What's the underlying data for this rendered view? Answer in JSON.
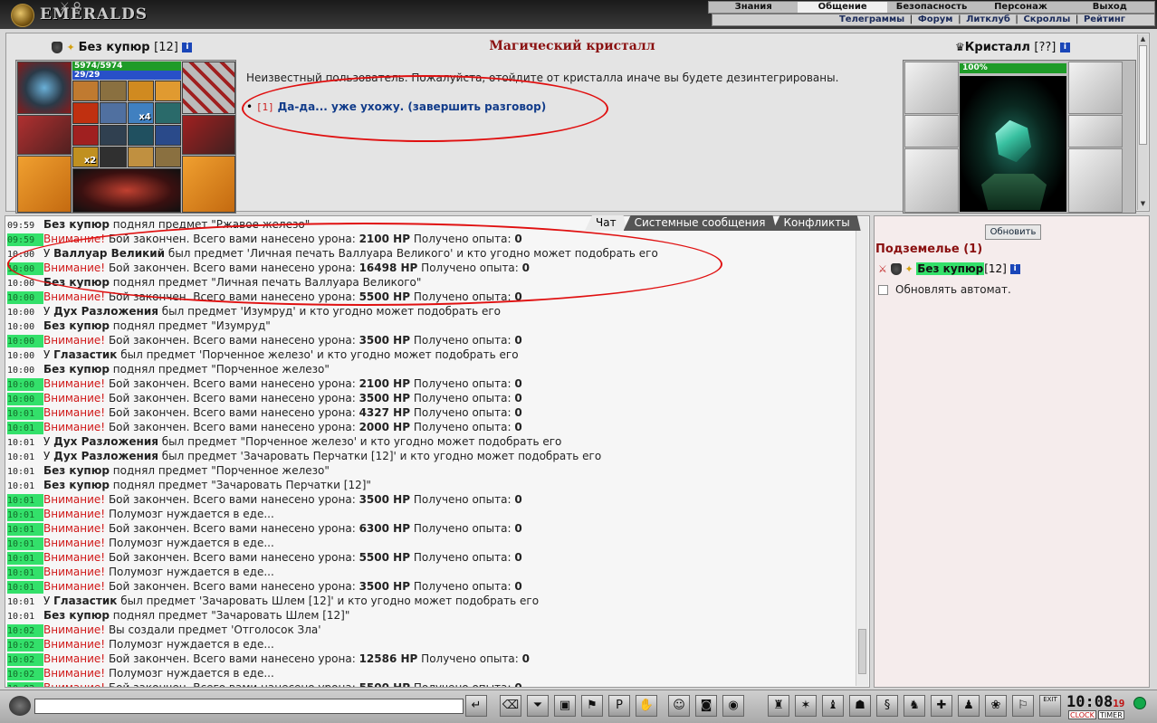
{
  "app": {
    "logo_text": "EMERALDS"
  },
  "topmenu": [
    "Знания",
    "Общение",
    "Безопасность",
    "Персонаж",
    "Выход"
  ],
  "submenu": [
    "Телеграммы",
    "Форум",
    "Литклуб",
    "Скроллы",
    "Рейтинг"
  ],
  "player": {
    "name": "Без купюр",
    "level": "[12]",
    "hp": "5974/5974",
    "mp": "29/29",
    "counts": {
      "slot_a": "x4",
      "slot_b": "x2"
    }
  },
  "dialog": {
    "title": "Магический кристалл",
    "text": "Неизвестный пользователь. Пожалуйста, отойдите от кристалла иначе вы будете дезинтегрированы.",
    "option_num": "[1]",
    "option_text": "Да-да... уже ухожу. (завершить разговор)"
  },
  "npc": {
    "name": "Кристалл",
    "level": "[??]",
    "hp": "100%"
  },
  "tabs": [
    "Чат",
    "Системные сообщения",
    "Конфликты"
  ],
  "chat_lines": [
    {
      "t": "09:59",
      "hl": false,
      "parts": [
        [
          "b",
          "Без купюр"
        ],
        [
          "",
          "поднял предмет \"Ржавое железо\""
        ]
      ]
    },
    {
      "t": "09:59",
      "hl": true,
      "parts": [
        [
          "w",
          "Внимание!"
        ],
        [
          "",
          "Бой закончен. Всего вами нанесено урона:"
        ],
        [
          "b",
          "2100 HP"
        ],
        [
          "",
          "Получено опыта:"
        ],
        [
          "b",
          "0"
        ]
      ]
    },
    {
      "t": "10:00",
      "hl": false,
      "parts": [
        [
          "",
          "У"
        ],
        [
          "b",
          "Валлуар Великий"
        ],
        [
          "",
          "был предмет 'Личная печать Валлуара Великого' и кто угодно может подобрать его"
        ]
      ]
    },
    {
      "t": "10:00",
      "hl": true,
      "parts": [
        [
          "w",
          "Внимание!"
        ],
        [
          "",
          "Бой закончен. Всего вами нанесено урона:"
        ],
        [
          "b",
          "16498 HP"
        ],
        [
          "",
          "Получено опыта:"
        ],
        [
          "b",
          "0"
        ]
      ]
    },
    {
      "t": "10:00",
      "hl": false,
      "parts": [
        [
          "b",
          "Без купюр"
        ],
        [
          "",
          "поднял предмет \"Личная печать Валлуара Великого\""
        ]
      ]
    },
    {
      "t": "10:00",
      "hl": true,
      "parts": [
        [
          "w",
          "Внимание!"
        ],
        [
          "",
          "Бой закончен. Всего вами нанесено урона:"
        ],
        [
          "b",
          "5500 HP"
        ],
        [
          "",
          "Получено опыта:"
        ],
        [
          "b",
          "0"
        ]
      ]
    },
    {
      "t": "10:00",
      "hl": false,
      "parts": [
        [
          "",
          "У"
        ],
        [
          "b",
          "Дух Разложения"
        ],
        [
          "",
          "был предмет 'Изумруд' и кто угодно может подобрать его"
        ]
      ]
    },
    {
      "t": "10:00",
      "hl": false,
      "parts": [
        [
          "b",
          "Без купюр"
        ],
        [
          "",
          "поднял предмет \"Изумруд\""
        ]
      ]
    },
    {
      "t": "10:00",
      "hl": true,
      "parts": [
        [
          "w",
          "Внимание!"
        ],
        [
          "",
          "Бой закончен. Всего вами нанесено урона:"
        ],
        [
          "b",
          "3500 HP"
        ],
        [
          "",
          "Получено опыта:"
        ],
        [
          "b",
          "0"
        ]
      ]
    },
    {
      "t": "10:00",
      "hl": false,
      "parts": [
        [
          "",
          "У"
        ],
        [
          "b",
          "Глазастик"
        ],
        [
          "",
          "был предмет 'Порченное железо' и кто угодно может подобрать его"
        ]
      ]
    },
    {
      "t": "10:00",
      "hl": false,
      "parts": [
        [
          "b",
          "Без купюр"
        ],
        [
          "",
          "поднял предмет \"Порченное железо\""
        ]
      ]
    },
    {
      "t": "10:00",
      "hl": true,
      "parts": [
        [
          "w",
          "Внимание!"
        ],
        [
          "",
          "Бой закончен. Всего вами нанесено урона:"
        ],
        [
          "b",
          "2100 HP"
        ],
        [
          "",
          "Получено опыта:"
        ],
        [
          "b",
          "0"
        ]
      ]
    },
    {
      "t": "10:00",
      "hl": true,
      "parts": [
        [
          "w",
          "Внимание!"
        ],
        [
          "",
          "Бой закончен. Всего вами нанесено урона:"
        ],
        [
          "b",
          "3500 HP"
        ],
        [
          "",
          "Получено опыта:"
        ],
        [
          "b",
          "0"
        ]
      ]
    },
    {
      "t": "10:01",
      "hl": true,
      "parts": [
        [
          "w",
          "Внимание!"
        ],
        [
          "",
          "Бой закончен. Всего вами нанесено урона:"
        ],
        [
          "b",
          "4327 HP"
        ],
        [
          "",
          "Получено опыта:"
        ],
        [
          "b",
          "0"
        ]
      ]
    },
    {
      "t": "10:01",
      "hl": true,
      "parts": [
        [
          "w",
          "Внимание!"
        ],
        [
          "",
          "Бой закончен. Всего вами нанесено урона:"
        ],
        [
          "b",
          "2000 HP"
        ],
        [
          "",
          "Получено опыта:"
        ],
        [
          "b",
          "0"
        ]
      ]
    },
    {
      "t": "10:01",
      "hl": false,
      "parts": [
        [
          "",
          "У"
        ],
        [
          "b",
          "Дух Разложения"
        ],
        [
          "",
          "был предмет \"Порченное железо' и кто угодно может подобрать его"
        ]
      ]
    },
    {
      "t": "10:01",
      "hl": false,
      "parts": [
        [
          "",
          "У"
        ],
        [
          "b",
          "Дух Разложения"
        ],
        [
          "",
          "был предмет 'Зачаровать Перчатки [12]' и кто угодно может подобрать его"
        ]
      ]
    },
    {
      "t": "10:01",
      "hl": false,
      "parts": [
        [
          "b",
          "Без купюр"
        ],
        [
          "",
          "поднял предмет \"Порченное железо\""
        ]
      ]
    },
    {
      "t": "10:01",
      "hl": false,
      "parts": [
        [
          "b",
          "Без купюр"
        ],
        [
          "",
          "поднял предмет \"Зачаровать Перчатки [12]\""
        ]
      ]
    },
    {
      "t": "10:01",
      "hl": true,
      "parts": [
        [
          "w",
          "Внимание!"
        ],
        [
          "",
          "Бой закончен. Всего вами нанесено урона:"
        ],
        [
          "b",
          "3500 HP"
        ],
        [
          "",
          "Получено опыта:"
        ],
        [
          "b",
          "0"
        ]
      ]
    },
    {
      "t": "10:01",
      "hl": true,
      "parts": [
        [
          "w",
          "Внимание!"
        ],
        [
          "",
          "Полумозг нуждается в еде..."
        ]
      ]
    },
    {
      "t": "10:01",
      "hl": true,
      "parts": [
        [
          "w",
          "Внимание!"
        ],
        [
          "",
          "Бой закончен. Всего вами нанесено урона:"
        ],
        [
          "b",
          "6300 HP"
        ],
        [
          "",
          "Получено опыта:"
        ],
        [
          "b",
          "0"
        ]
      ]
    },
    {
      "t": "10:01",
      "hl": true,
      "parts": [
        [
          "w",
          "Внимание!"
        ],
        [
          "",
          "Полумозг нуждается в еде..."
        ]
      ]
    },
    {
      "t": "10:01",
      "hl": true,
      "parts": [
        [
          "w",
          "Внимание!"
        ],
        [
          "",
          "Бой закончен. Всего вами нанесено урона:"
        ],
        [
          "b",
          "5500 HP"
        ],
        [
          "",
          "Получено опыта:"
        ],
        [
          "b",
          "0"
        ]
      ]
    },
    {
      "t": "10:01",
      "hl": true,
      "parts": [
        [
          "w",
          "Внимание!"
        ],
        [
          "",
          "Полумозг нуждается в еде..."
        ]
      ]
    },
    {
      "t": "10:01",
      "hl": true,
      "parts": [
        [
          "w",
          "Внимание!"
        ],
        [
          "",
          "Бой закончен. Всего вами нанесено урона:"
        ],
        [
          "b",
          "3500 HP"
        ],
        [
          "",
          "Получено опыта:"
        ],
        [
          "b",
          "0"
        ]
      ]
    },
    {
      "t": "10:01",
      "hl": false,
      "parts": [
        [
          "",
          "У"
        ],
        [
          "b",
          "Глазастик"
        ],
        [
          "",
          "был предмет 'Зачаровать Шлем [12]' и кто угодно может подобрать его"
        ]
      ]
    },
    {
      "t": "10:01",
      "hl": false,
      "parts": [
        [
          "b",
          "Без купюр"
        ],
        [
          "",
          "поднял предмет \"Зачаровать Шлем [12]\""
        ]
      ]
    },
    {
      "t": "10:02",
      "hl": true,
      "parts": [
        [
          "w",
          "Внимание!"
        ],
        [
          "",
          "Вы создали предмет 'Отголосок Зла'"
        ]
      ]
    },
    {
      "t": "10:02",
      "hl": true,
      "parts": [
        [
          "w",
          "Внимание!"
        ],
        [
          "",
          "Полумозг нуждается в еде..."
        ]
      ]
    },
    {
      "t": "10:02",
      "hl": true,
      "parts": [
        [
          "w",
          "Внимание!"
        ],
        [
          "",
          "Бой закончен. Всего вами нанесено урона:"
        ],
        [
          "b",
          "12586 HP"
        ],
        [
          "",
          "Получено опыта:"
        ],
        [
          "b",
          "0"
        ]
      ]
    },
    {
      "t": "10:02",
      "hl": true,
      "parts": [
        [
          "w",
          "Внимание!"
        ],
        [
          "",
          "Полумозг нуждается в еде..."
        ]
      ]
    },
    {
      "t": "10:02",
      "hl": true,
      "parts": [
        [
          "w",
          "Внимание!"
        ],
        [
          "",
          "Бой закончен. Всего вами нанесено урона:"
        ],
        [
          "b",
          "5500 HP"
        ],
        [
          "",
          "Получено опыта:"
        ],
        [
          "b",
          "0"
        ]
      ]
    }
  ],
  "right_panel": {
    "refresh_label": "Обновить",
    "dungeon_title": "Подземелье (1)",
    "member_name": "Без купюр",
    "member_level": "[12]",
    "auto_label": "Обновлять автомат."
  },
  "clock": {
    "time": "10:08",
    "seconds": "19",
    "clock_label": "CLOCK",
    "timer_label": "TIMER",
    "exit_label": "EXIT"
  },
  "colors": {
    "warning": "#d01818",
    "highlight": "#33e06a",
    "title": "#8a1010"
  }
}
